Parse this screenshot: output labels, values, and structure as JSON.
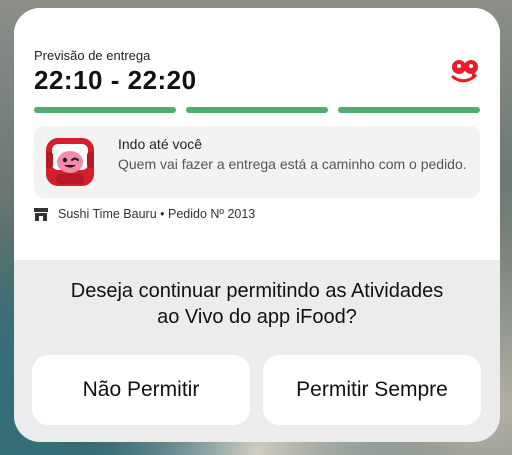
{
  "live_activity": {
    "eta_label": "Previsão de entrega",
    "eta_time": "22:10 - 22:20",
    "progress": {
      "completed_steps": 3,
      "total_steps": 3,
      "color": "#4caf72"
    },
    "status": {
      "title": "Indo até você",
      "description": "Quem vai fazer a entrega está a caminho com o pedido."
    },
    "store_line": "Sushi Time Bauru • Pedido Nº 2013",
    "brand_color": "#ea1d2c",
    "icons": [
      "ifood-logo-icon",
      "courier-avatar-icon",
      "store-icon"
    ]
  },
  "alert": {
    "message_line1": "Deseja continuar permitindo as Atividades",
    "message_line2": "ao Vivo do app iFood?",
    "deny_label": "Não Permitir",
    "allow_label": "Permitir Sempre"
  }
}
